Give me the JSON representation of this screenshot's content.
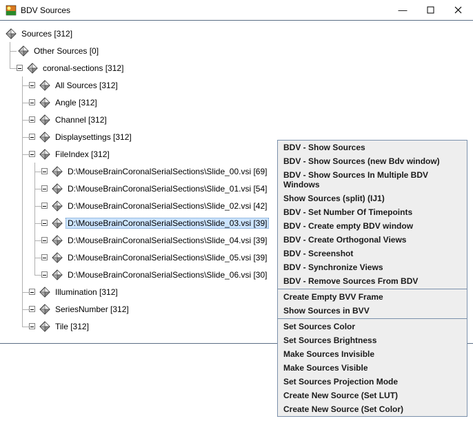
{
  "title": "BDV Sources",
  "tree": {
    "root": "Sources [312]",
    "children": [
      {
        "label": "Other Sources [0]"
      },
      {
        "label": "coronal-sections [312]",
        "children": [
          {
            "label": "All Sources [312]"
          },
          {
            "label": "Angle [312]"
          },
          {
            "label": "Channel [312]"
          },
          {
            "label": "Displaysettings [312]"
          },
          {
            "label": "FileIndex [312]",
            "children": [
              {
                "label": "D:\\MouseBrainCoronalSerialSections\\Slide_00.vsi [69]"
              },
              {
                "label": "D:\\MouseBrainCoronalSerialSections\\Slide_01.vsi [54]"
              },
              {
                "label": "D:\\MouseBrainCoronalSerialSections\\Slide_02.vsi [42]"
              },
              {
                "label": "D:\\MouseBrainCoronalSerialSections\\Slide_03.vsi [39]",
                "selected": true
              },
              {
                "label": "D:\\MouseBrainCoronalSerialSections\\Slide_04.vsi [39]"
              },
              {
                "label": "D:\\MouseBrainCoronalSerialSections\\Slide_05.vsi [39]"
              },
              {
                "label": "D:\\MouseBrainCoronalSerialSections\\Slide_06.vsi [30]"
              }
            ]
          },
          {
            "label": "Illumination [312]"
          },
          {
            "label": "SeriesNumber [312]"
          },
          {
            "label": "Tile [312]"
          }
        ]
      }
    ]
  },
  "contextMenu": [
    "BDV - Show Sources",
    "BDV - Show Sources (new Bdv window)",
    "BDV - Show Sources In Multiple BDV Windows",
    "Show Sources (split) (IJ1)",
    "BDV - Set Number Of Timepoints",
    "BDV - Create empty BDV window",
    "BDV - Create Orthogonal Views",
    "BDV - Screenshot",
    "BDV - Synchronize Views",
    "BDV - Remove Sources From BDV",
    "---",
    "Create Empty BVV Frame",
    "Show Sources in BVV",
    "---",
    "Set Sources Color",
    "Set Sources Brightness",
    "Make Sources Invisible",
    "Make Sources Visible",
    "Set Sources Projection Mode",
    "Create New Source (Set LUT)",
    "Create New Source (Set Color)"
  ]
}
